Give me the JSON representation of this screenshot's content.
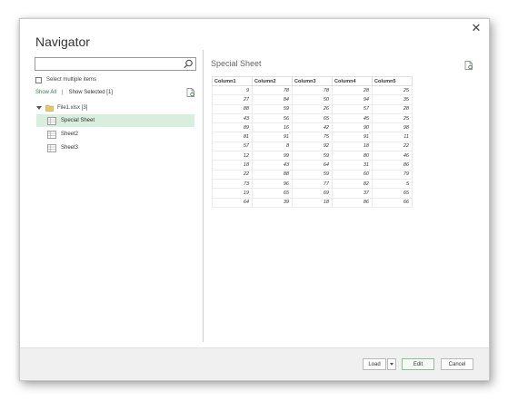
{
  "dialog": {
    "title": "Navigator",
    "close_glyph": "✕"
  },
  "navigator": {
    "search": {
      "value": "",
      "placeholder": ""
    },
    "select_multiple_label": "Select multiple items",
    "show_all_label": "Show All",
    "separator": "|",
    "show_selected_label": "Show Selected [1]",
    "tree": {
      "root_label": "File1.xlsx [3]",
      "items": [
        {
          "label": "Special Sheet",
          "selected": true
        },
        {
          "label": "Sheet2",
          "selected": false
        },
        {
          "label": "Sheet3",
          "selected": false
        }
      ]
    }
  },
  "preview": {
    "title": "Special Sheet",
    "columns": [
      "Column1",
      "Column2",
      "Column3",
      "Column4",
      "Column5"
    ],
    "rows": [
      [
        9,
        78,
        78,
        28,
        25
      ],
      [
        27,
        84,
        50,
        94,
        35
      ],
      [
        88,
        59,
        26,
        57,
        28
      ],
      [
        43,
        56,
        65,
        45,
        25
      ],
      [
        89,
        16,
        42,
        90,
        98
      ],
      [
        81,
        91,
        75,
        91,
        11
      ],
      [
        57,
        8,
        92,
        18,
        22
      ],
      [
        12,
        99,
        59,
        80,
        46
      ],
      [
        18,
        43,
        64,
        31,
        86
      ],
      [
        22,
        88,
        59,
        60,
        79
      ],
      [
        73,
        96,
        77,
        82,
        5
      ],
      [
        19,
        65,
        69,
        37,
        65
      ],
      [
        64,
        39,
        18,
        86,
        66
      ]
    ]
  },
  "footer": {
    "load_label": "Load",
    "edit_label": "Edit",
    "cancel_label": "Cancel"
  },
  "icons": {
    "search": "search-icon",
    "refresh": "refresh-icon",
    "folder": "folder-icon",
    "sheet": "sheet-icon"
  },
  "colors": {
    "accent_green": "#2e7a4a",
    "selected_row": "#d8eedf"
  }
}
